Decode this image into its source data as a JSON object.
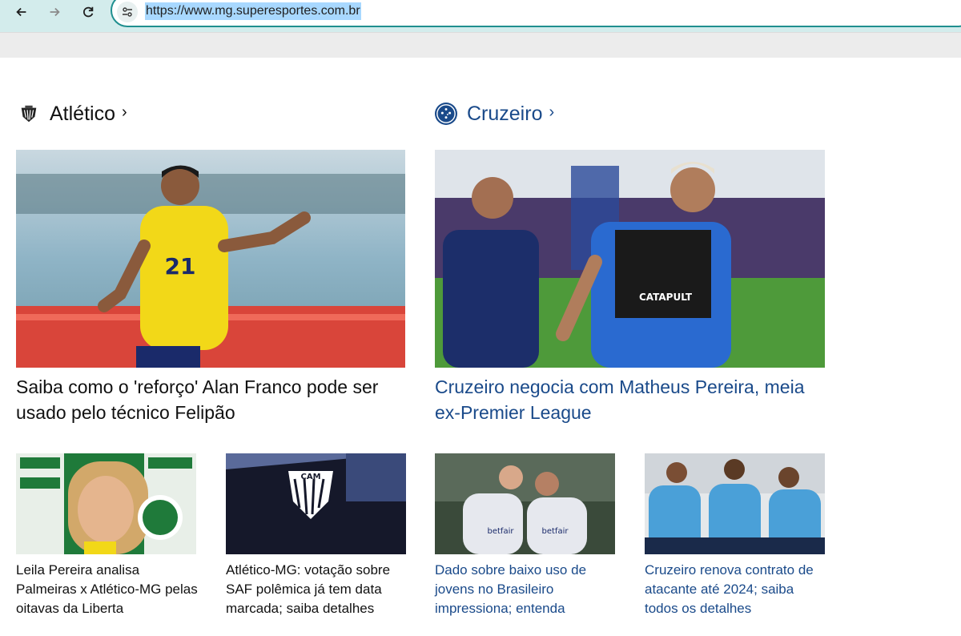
{
  "browser": {
    "url": "https://www.mg.superesportes.com.br",
    "back_icon": "arrow-left-icon",
    "forward_icon": "arrow-right-icon",
    "reload_icon": "reload-icon",
    "site_info_icon": "tune-icon"
  },
  "sections": {
    "atletico": {
      "title": "Atlético",
      "chevron": "›",
      "color": "#111111",
      "lead": {
        "headline": "Saiba como o 'reforço' Alan Franco pode ser usado pelo técnico Felipão"
      },
      "items": [
        {
          "headline": "Leila Pereira analisa Palmeiras x Atlético-MG pelas oitavas da Liberta"
        },
        {
          "headline": "Atlético-MG: votação sobre SAF polêmica já tem data marcada; saiba detalhes"
        }
      ]
    },
    "cruzeiro": {
      "title": "Cruzeiro",
      "chevron": "›",
      "color": "#1a4a8a",
      "lead": {
        "headline": "Cruzeiro negocia com Matheus Pereira, meia ex-Premier League"
      },
      "items": [
        {
          "headline": "Dado sobre baixo uso de jovens no Brasileiro impressiona; entenda"
        },
        {
          "headline": "Cruzeiro renova contrato de atacante até 2024; saiba todos os detalhes"
        }
      ]
    }
  }
}
